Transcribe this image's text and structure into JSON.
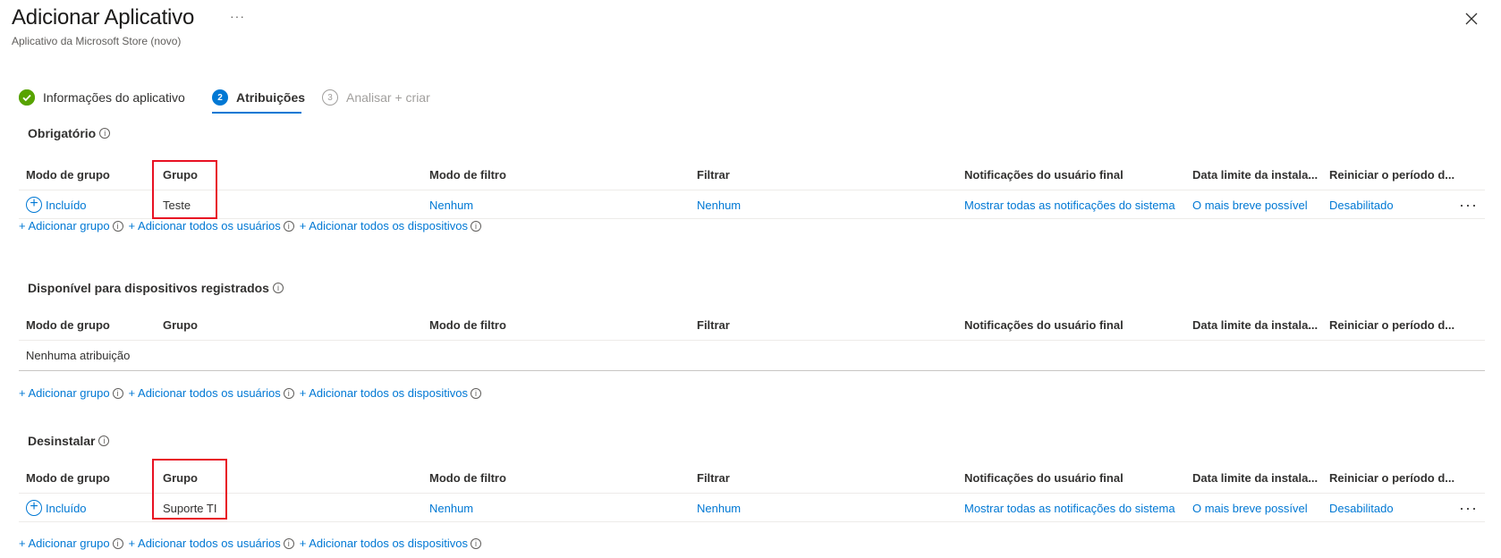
{
  "header": {
    "title": "Adicionar Aplicativo",
    "more": "···",
    "subtitle": "Aplicativo da Microsoft Store (novo)"
  },
  "steps": [
    {
      "label": "Informações do aplicativo",
      "state": "done",
      "marker": "✓"
    },
    {
      "label": "Atribuições",
      "state": "active",
      "marker": "2"
    },
    {
      "label": "Analisar + criar",
      "state": "disabled",
      "marker": "3"
    }
  ],
  "columns": [
    "Modo de grupo",
    "Grupo",
    "Modo de filtro",
    "Filtrar",
    "Notificações do usuário final",
    "Data limite da instala...",
    "Reiniciar o período d..."
  ],
  "add_links": {
    "add_group": "+ Adicionar grupo",
    "add_all_users": "+ Adicionar todos os usuários",
    "add_all_devices": "+ Adicionar todos os dispositivos"
  },
  "sections": {
    "required": {
      "title": "Obrigatório",
      "row": {
        "mode": "Incluído",
        "group": "Teste",
        "filter_mode": "Nenhum",
        "filter": "Nenhum",
        "notifications": "Mostrar todas as notificações do sistema",
        "deadline": "O mais breve possível",
        "restart": "Desabilitado",
        "more": "···"
      }
    },
    "available": {
      "title": "Disponível para dispositivos registrados",
      "empty": "Nenhuma atribuição"
    },
    "uninstall": {
      "title": "Desinstalar",
      "row": {
        "mode": "Incluído",
        "group": "Suporte TI",
        "filter_mode": "Nenhum",
        "filter": "Nenhum",
        "notifications": "Mostrar todas as notificações do sistema",
        "deadline": "O mais breve possível",
        "restart": "Desabilitado",
        "more": "···"
      }
    }
  },
  "icons": {
    "info": "i",
    "plus": "+",
    "close": "close-icon",
    "check": "check-icon"
  },
  "colors": {
    "accent": "#0078d4",
    "success": "#57a300",
    "highlight": "#e81123"
  }
}
